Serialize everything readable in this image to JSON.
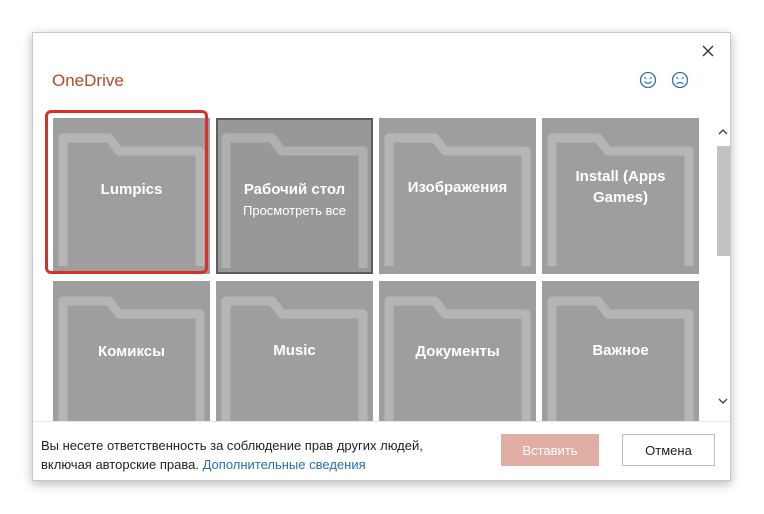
{
  "dialog": {
    "title": "OneDrive",
    "close_icon": "close-icon",
    "smile_icon": "smile-icon",
    "frown_icon": "frown-icon"
  },
  "folders": [
    {
      "label": "Lumpics",
      "sublabel": ""
    },
    {
      "label": "Рабочий стол",
      "sublabel": "Просмотреть все"
    },
    {
      "label": "Изображения",
      "sublabel": ""
    },
    {
      "label": "Install (Apps Games)",
      "sublabel": ""
    },
    {
      "label": "Комиксы",
      "sublabel": ""
    },
    {
      "label": "Music",
      "sublabel": ""
    },
    {
      "label": "Документы",
      "sublabel": ""
    },
    {
      "label": "Важное",
      "sublabel": ""
    }
  ],
  "footer": {
    "text": "Вы несете ответственность за соблюдение прав других людей, включая авторские права.",
    "link": "Дополнительные сведения"
  },
  "buttons": {
    "insert": "Вставить",
    "cancel": "Отмена"
  },
  "colors": {
    "title": "#b7472a",
    "tile": "#9e9e9e",
    "highlight": "#d9302c",
    "insert_button": "#e1aea5",
    "link": "#2a6cb5"
  }
}
